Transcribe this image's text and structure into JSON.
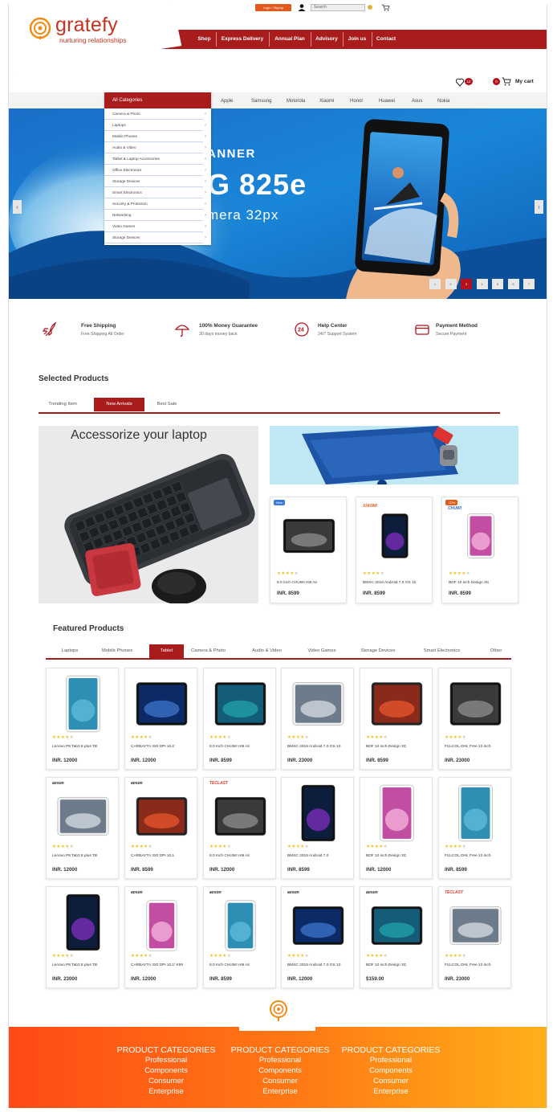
{
  "header": {
    "login_label": "Login / Signup",
    "search_placeholder": "Search",
    "logo_name": "gratefy",
    "logo_tagline": "nurturing relationships",
    "nav": [
      "Shop",
      "Express Delivery",
      "Annual Plan",
      "Advisory",
      "Join us",
      "Contact"
    ],
    "wishlist_count": "12",
    "cart_count": "0",
    "cart_label": "My cart"
  },
  "categories": {
    "heading": "All Categories",
    "items": [
      "Camera & Photo",
      "Laptops",
      "Mobile Phones",
      "Audio & Video",
      "Tablet & Laptop Accessories",
      "Office Electronics",
      "Storage Devices",
      "Smart Electronics",
      "Security & Protection",
      "Networking",
      "Video Games",
      "Storage Devices"
    ]
  },
  "brands": [
    "Apple",
    "Samsung",
    "Motorola",
    "Xiaomi",
    "Honor",
    "Huawei",
    "Asus",
    "Nokia"
  ],
  "hero": {
    "line1": "ANNER",
    "line2": "G 825e",
    "line3": "mera 32px",
    "prev": "‹",
    "next": "›",
    "dots": [
      "1",
      "2",
      "3",
      "4",
      "5",
      "6",
      "7"
    ],
    "active_dot": 3
  },
  "services": [
    {
      "title": "Free Shipping",
      "sub": "Free Shipping All Order",
      "icon": "rocket-icon"
    },
    {
      "title": "100% Money Guarantee",
      "sub": "30 days money back",
      "icon": "umbrella-icon"
    },
    {
      "title": "Help Center",
      "sub": "24/7 Support System",
      "icon": "support-24-icon"
    },
    {
      "title": "Payment Method",
      "sub": "Secure Payment",
      "icon": "credit-card-icon"
    }
  ],
  "selected": {
    "title": "Selected Products",
    "tabs": [
      "Trending Item",
      "New Arrivals",
      "Best Sale"
    ],
    "active_tab": 1,
    "promo_text": "Accessorize your laptop",
    "cards": [
      {
        "badge": "New",
        "name": "8.0 Inch CHUWI Hi8 Air",
        "price": "INR. 8599",
        "rating": 4
      },
      {
        "brand": "XIAOMI",
        "name": "BMXC 2018 Android 7.0 OS 10",
        "price": "INR. 8599",
        "rating": 4
      },
      {
        "badge": "-20%",
        "brand": "CHUWI",
        "name": "BDF 10 inch Design 3G",
        "price": "INR. 8599",
        "rating": 4
      }
    ]
  },
  "featured": {
    "title": "Featured Products",
    "tabs": [
      "Laptops",
      "Mobile Phones",
      "Tablet",
      "Camera & Photo",
      "Audio & Video",
      "Video Games",
      "Storage Devices",
      "Smart Electronics",
      "Other"
    ],
    "active_tab": 2,
    "rows": [
      [
        {
          "name": "Lenovo P8 Tab3 8 plus TB",
          "price": "INR. 12000",
          "rating": 4
        },
        {
          "name": "CARBAYTA 320 DPI 10.1'",
          "price": "INR. 12000",
          "rating": 4
        },
        {
          "name": "8.0 Inch CHUWI Hi8 Air",
          "price": "INR. 8599",
          "rating": 4
        },
        {
          "name": "BMXC 2018 Android 7.0 OS 10",
          "price": "INR. 23000",
          "rating": 4
        },
        {
          "name": "BDF 10 inch Design 3G",
          "price": "INR. 8599",
          "rating": 4
        },
        {
          "name": "FULCOL DHL Free 10 inch",
          "price": "INR. 23000",
          "rating": 4
        }
      ],
      [
        {
          "brand": "aoson",
          "name": "Lenovo P8 Tab3 8 plus TB",
          "price": "INR. 12000",
          "rating": 4
        },
        {
          "brand": "aoson",
          "name": "CARBAYTA 320 DPI 10.1",
          "price": "INR. 8599",
          "rating": 4
        },
        {
          "brand": "TECLAST",
          "name": "8.0 Inch CHUWI Hi8 Air",
          "price": "INR. 12000",
          "rating": 4
        },
        {
          "name": "BMXC 2018 Android 7.0",
          "price": "INR. 8599",
          "rating": 4
        },
        {
          "name": "BDF 10 inch Design 3G",
          "price": "INR. 12000",
          "rating": 4
        },
        {
          "name": "FULCOL DHL Free 10 inch",
          "price": "INR. 8599",
          "rating": 4
        }
      ],
      [
        {
          "name": "Lenovo P8 Tab3 8 plus TB",
          "price": "INR. 23000",
          "rating": 4
        },
        {
          "brand": "aoson",
          "name": "CARBAYTA 320 DPI 10.1' K99",
          "price": "INR. 12000",
          "rating": 4
        },
        {
          "brand": "aoson",
          "name": "8.0 Inch CHUWI Hi8 Air",
          "price": "INR. 8599",
          "rating": 4
        },
        {
          "brand": "aoson",
          "name": "BMXC 2018 Android 7.0 OS 10",
          "price": "INR. 12000",
          "rating": 4
        },
        {
          "brand": "aoson",
          "name": "BDF 10 inch Design 3G",
          "price": "$159.00",
          "rating": 4
        },
        {
          "brand": "TECLAST",
          "name": "FULCOL DHL Free 10 inch",
          "price": "INR. 23000",
          "rating": 4
        }
      ]
    ]
  },
  "footer": {
    "columns": [
      {
        "heading": "PRODUCT CATEGORIES",
        "links": [
          "Professional",
          "Components",
          "Consumer",
          "Enterprise"
        ]
      },
      {
        "heading": "PRODUCT CATEGORIES",
        "links": [
          "Professional",
          "Components",
          "Consumer",
          "Enterprise"
        ]
      },
      {
        "heading": "PRODUCT CATEGORIES",
        "links": [
          "Professional",
          "Components",
          "Consumer",
          "Enterprise"
        ]
      }
    ]
  },
  "colors": {
    "brand_red": "#a81c1c",
    "accent_orange": "#e25a1c",
    "star": "#f2c21b"
  }
}
